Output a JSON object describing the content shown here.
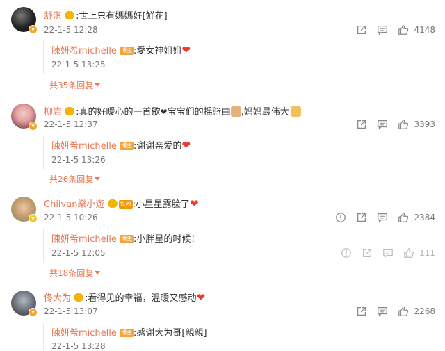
{
  "comments": [
    {
      "user": "舒淇",
      "text": ":世上只有媽媽好[鮮花]",
      "time": "22-1-5 12:28",
      "likes": "4148",
      "reply": {
        "user": "陳妍希michelle",
        "badge": "博主",
        "text": ":愛女神姐姐",
        "time": "22-1-5 13:25"
      },
      "more": "共35条回复"
    },
    {
      "user": "柳岩",
      "text_a": ":真的好暖心的一首歌",
      "text_b": "宝宝们的摇篮曲",
      "text_c": ",妈妈最伟大",
      "time": "22-1-5 12:37",
      "likes": "3393",
      "reply": {
        "user": "陳妍希michelle",
        "badge": "博主",
        "text": ":谢谢亲爱的",
        "time": "22-1-5 13:26"
      },
      "more": "共26条回复"
    },
    {
      "user": "Chiivan樂小遊",
      "tag": "铁粉",
      "text": ":小星星露脸了",
      "time": "22-1-5 10:26",
      "likes": "2384",
      "reply": {
        "user": "陳妍希michelle",
        "badge": "博主",
        "text": ":小胖星的时候！",
        "time": "22-1-5 12:05",
        "likes": "111"
      },
      "more": "共18条回复"
    },
    {
      "user": "佟大为",
      "text": ":看得见的幸福，温暖又感动",
      "time": "22-1-5 13:07",
      "likes": "2268",
      "reply": {
        "user": "陳妍希michelle",
        "badge": "博主",
        "text": ":感谢大为哥[親親]",
        "time": "22-1-5 13:28"
      }
    }
  ],
  "icons": {
    "share": "share-icon",
    "comment": "comment-icon",
    "like": "thumbs-up-icon",
    "report": "report-icon"
  },
  "colors": {
    "username": "#eb7350",
    "verified": "#f6a623",
    "heart": "#f03a2f"
  }
}
